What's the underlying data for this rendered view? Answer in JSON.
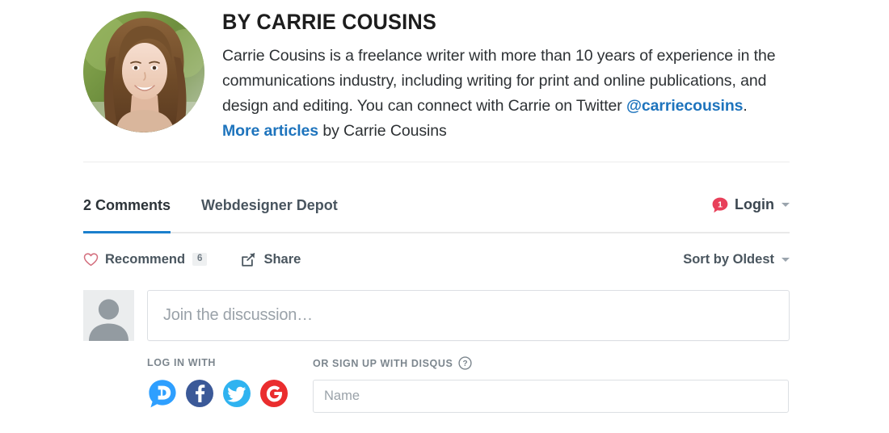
{
  "author": {
    "avatar_alt": "Carrie Cousins portrait",
    "name": "BY CARRIE COUSINS",
    "bio_part1": "Carrie Cousins is a freelance writer with more than 10 years of experience in the communications industry, including writing for print and online publications, and design and editing. You can connect with Carrie on Twitter ",
    "twitter_link": "@carriecousins",
    "bio_separator": ". ",
    "more_articles_link": "More articles",
    "bio_suffix": " by Carrie Cousins"
  },
  "disqus": {
    "tabs": [
      {
        "label": "2 Comments",
        "active": true
      },
      {
        "label": "Webdesigner Depot",
        "active": false
      }
    ],
    "login": {
      "badge_count": "1",
      "label": "Login",
      "caret_icon": "chevron-down-icon"
    },
    "actions": {
      "recommend_label": "Recommend",
      "recommend_count": "6",
      "recommend_icon": "heart-icon",
      "share_label": "Share",
      "share_icon": "share-icon"
    },
    "sort": {
      "label": "Sort by Oldest",
      "caret_icon": "chevron-down-icon"
    },
    "composer": {
      "avatar_icon": "user-avatar-icon",
      "placeholder": "Join the discussion…"
    },
    "signup": {
      "login_with_label": "LOG IN WITH",
      "or_signup_label": "OR SIGN UP WITH DISQUS",
      "help_icon": "question-mark-icon",
      "social": [
        {
          "name": "disqus-login-icon",
          "label": "Disqus",
          "color": "#2e9fff"
        },
        {
          "name": "facebook-login-icon",
          "label": "Facebook",
          "color": "#3b5998"
        },
        {
          "name": "twitter-login-icon",
          "label": "Twitter",
          "color": "#2fb3f0"
        },
        {
          "name": "google-login-icon",
          "label": "Google",
          "color": "#ea2d2e"
        }
      ],
      "name_placeholder": "Name"
    }
  },
  "colors": {
    "accent_blue": "#1b7fcc",
    "link_blue": "#1e74bd",
    "badge_red": "#e8405a",
    "heart_pink": "#d4707f",
    "text_dark": "#2d3134",
    "text_muted": "#7c868e"
  }
}
